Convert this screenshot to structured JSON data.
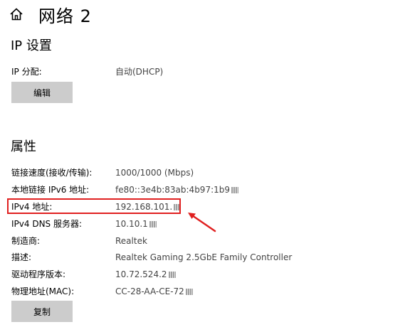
{
  "header": {
    "title": "网络 2",
    "home_icon": "home-icon"
  },
  "ip_settings": {
    "section_title": "IP 设置",
    "assignment_label": "IP 分配:",
    "assignment_value": "自动(DHCP)",
    "edit_button": "编辑"
  },
  "properties": {
    "section_title": "属性",
    "rows": [
      {
        "label": "链接速度(接收/传输):",
        "value": "1000/1000 (Mbps)"
      },
      {
        "label": "本地链接 IPv6 地址:",
        "value": "fe80::3e4b:83ab:4b97:1b9"
      },
      {
        "label": "IPv4 地址:",
        "value": "192.168.101."
      },
      {
        "label": "IPv4 DNS 服务器:",
        "value": "10.10.1"
      },
      {
        "label": "制造商:",
        "value": "Realtek"
      },
      {
        "label": "描述:",
        "value": "Realtek Gaming 2.5GbE Family Controller"
      },
      {
        "label": "驱动程序版本:",
        "value": "10.72.524.2"
      },
      {
        "label": "物理地址(MAC):",
        "value": "CC-28-AA-CE-72"
      }
    ],
    "copy_button": "复制"
  },
  "colors": {
    "highlight": "#e02020",
    "button_bg": "#cccccc",
    "value_text": "#444444"
  }
}
